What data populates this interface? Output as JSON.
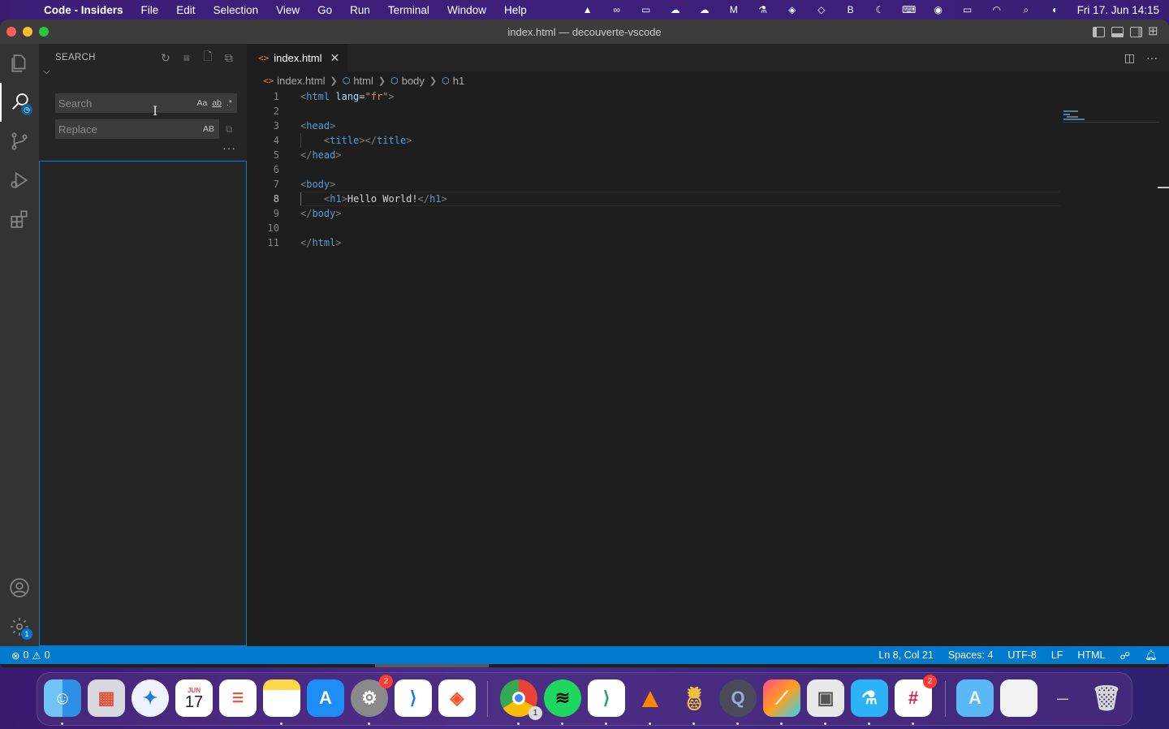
{
  "menubar": {
    "app_name": "Code - Insiders",
    "items": [
      "File",
      "Edit",
      "Selection",
      "View",
      "Go",
      "Run",
      "Terminal",
      "Window",
      "Help"
    ],
    "clock": "Fri 17. Jun  14:15",
    "status_icons": [
      "vlc-icon",
      "creative-cloud-icon",
      "screen-icon",
      "weather-icon",
      "cloudapp-icon",
      "mimestream-icon",
      "flask-icon",
      "bitwarden-icon",
      "vpn-icon",
      "bbedit-icon",
      "moon-icon",
      "keyboard-icon",
      "play-icon",
      "battery-icon",
      "wifi-icon",
      "search-icon",
      "control-center-icon"
    ]
  },
  "window": {
    "title": "index.html — decouverte-vscode"
  },
  "activity_bar": {
    "icons": [
      "explorer-icon",
      "search-icon",
      "source-control-icon",
      "run-debug-icon",
      "extensions-icon"
    ],
    "bottom_icons": [
      "account-icon",
      "manage-gear-icon"
    ],
    "settings_badge": "1"
  },
  "sidebar": {
    "title": "SEARCH",
    "search": {
      "placeholder": "Search",
      "value": ""
    },
    "replace": {
      "placeholder": "Replace",
      "value": ""
    },
    "options": {
      "match_case": "Aa",
      "whole_word": "ab",
      "regex": ".*",
      "preserve_case": "AB"
    }
  },
  "editor": {
    "tab": {
      "label": "index.html"
    },
    "breadcrumb": [
      "index.html",
      "html",
      "body",
      "h1"
    ],
    "lines": [
      {
        "n": "1"
      },
      {
        "n": "2"
      },
      {
        "n": "3"
      },
      {
        "n": "4"
      },
      {
        "n": "5"
      },
      {
        "n": "6"
      },
      {
        "n": "7"
      },
      {
        "n": "8"
      },
      {
        "n": "9"
      },
      {
        "n": "10"
      },
      {
        "n": "11"
      }
    ],
    "code": {
      "html_tag": "html",
      "lang_attr": "lang",
      "lang_value": "\"fr\"",
      "head_tag": "head",
      "title_tag": "title",
      "body_tag": "body",
      "h1_tag": "h1",
      "h1_text": "Hello World!"
    }
  },
  "statusbar": {
    "errors": "0",
    "warnings": "0",
    "position": "Ln 8, Col 21",
    "spaces": "Spaces: 4",
    "encoding": "UTF-8",
    "eol": "LF",
    "language": "HTML"
  },
  "dock": {
    "apps": [
      "Finder",
      "Launchpad",
      "Safari",
      "Calendar",
      "Reminders",
      "Notes",
      "App Store",
      "System Preferences",
      "VS Code",
      "Brave",
      "Chrome",
      "Spotify",
      "Code Insiders",
      "VLC",
      "Cocktail",
      "QuickTime",
      "Pixelmator",
      "Preview",
      "TestFlight",
      "Slack",
      "Applications",
      "Documents",
      "Downloads",
      "Trash"
    ],
    "calendar_month": "JUN",
    "calendar_day": "17",
    "system_prefs_badge": "2",
    "chrome_badge": "1",
    "slack_badge": "2"
  }
}
